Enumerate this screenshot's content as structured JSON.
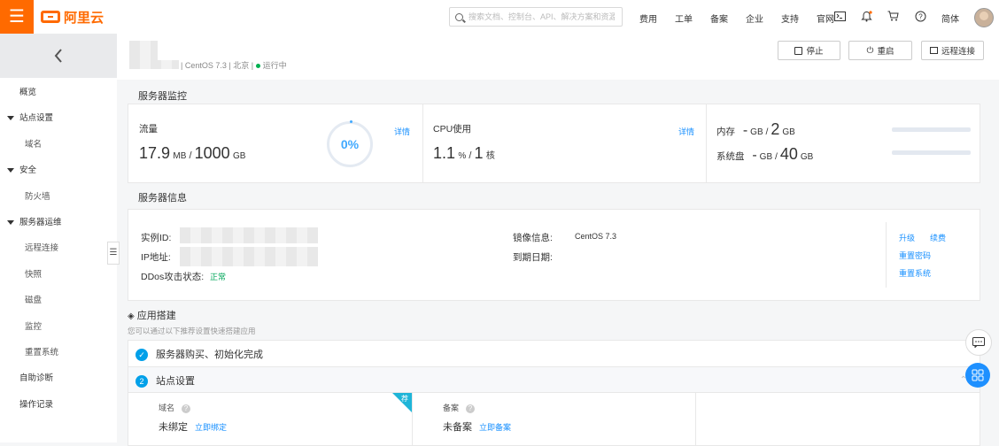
{
  "topbar": {
    "menu_icon": "menu-icon",
    "logo_text": "阿里云",
    "search_placeholder": "搜索文档、控制台、API、解决方案和资源",
    "nav": [
      "费用",
      "工单",
      "备案",
      "企业",
      "支持",
      "官网"
    ],
    "icons": [
      "terminal-icon",
      "bell-icon",
      "cart-icon",
      "help-icon"
    ],
    "lang": "简体",
    "accent_color": "#ff6a00"
  },
  "sidebar": {
    "back_icon": "chevron-left-icon",
    "items": [
      {
        "label": "概览",
        "kind": "l1"
      },
      {
        "label": "站点设置",
        "kind": "section"
      },
      {
        "label": "域名",
        "kind": "l2"
      },
      {
        "label": "安全",
        "kind": "section"
      },
      {
        "label": "防火墙",
        "kind": "l2"
      },
      {
        "label": "服务器运维",
        "kind": "section"
      },
      {
        "label": "远程连接",
        "kind": "l2"
      },
      {
        "label": "快照",
        "kind": "l2"
      },
      {
        "label": "磁盘",
        "kind": "l2"
      },
      {
        "label": "监控",
        "kind": "l2"
      },
      {
        "label": "重置系统",
        "kind": "l2"
      },
      {
        "label": "自助诊断",
        "kind": "l1"
      },
      {
        "label": "操作记录",
        "kind": "l1"
      }
    ]
  },
  "server": {
    "os": "CentOS 7.3",
    "region": "北京",
    "status": "运行中",
    "buttons": {
      "stop": "停止",
      "restart": "重启",
      "remote": "远程连接"
    }
  },
  "monitor": {
    "title": "服务器监控",
    "traffic": {
      "label": "流量",
      "used": "17.9",
      "used_unit": "MB",
      "total": "1000",
      "total_unit": "GB",
      "percent": "0%",
      "detail": "详情"
    },
    "cpu": {
      "label": "CPU使用",
      "used": "1.1",
      "used_unit": "%",
      "total": "1",
      "total_unit": "核",
      "detail": "详情"
    },
    "memory": {
      "label": "内存",
      "used": "-",
      "used_unit": "GB",
      "total": "2",
      "total_unit": "GB",
      "fill": 0
    },
    "disk": {
      "label": "系统盘",
      "used": "-",
      "used_unit": "GB",
      "total": "40",
      "total_unit": "GB",
      "fill": 0
    }
  },
  "info": {
    "title": "服务器信息",
    "instance_id_label": "实例ID:",
    "ip_label": "IP地址:",
    "ddos_label": "DDos攻击状态:",
    "ddos_value": "正常",
    "image_label": "镜像信息:",
    "image_value": "CentOS 7.3",
    "expire_label": "到期日期:",
    "actions": {
      "upgrade": "升级",
      "renew": "续费",
      "reset_pwd": "重置密码",
      "reset_sys": "重置系统"
    }
  },
  "app": {
    "title": "应用搭建",
    "subtitle": "您可以通过以下推荐设置快速搭建应用",
    "step1": "服务器购买、初始化完成",
    "step2_num": "2",
    "step2": "站点设置",
    "domain_label": "域名",
    "domain_value": "未绑定",
    "domain_link": "立即绑定",
    "badge": "荐",
    "icp_label": "备案",
    "icp_value": "未备案",
    "icp_link": "立即备案"
  }
}
